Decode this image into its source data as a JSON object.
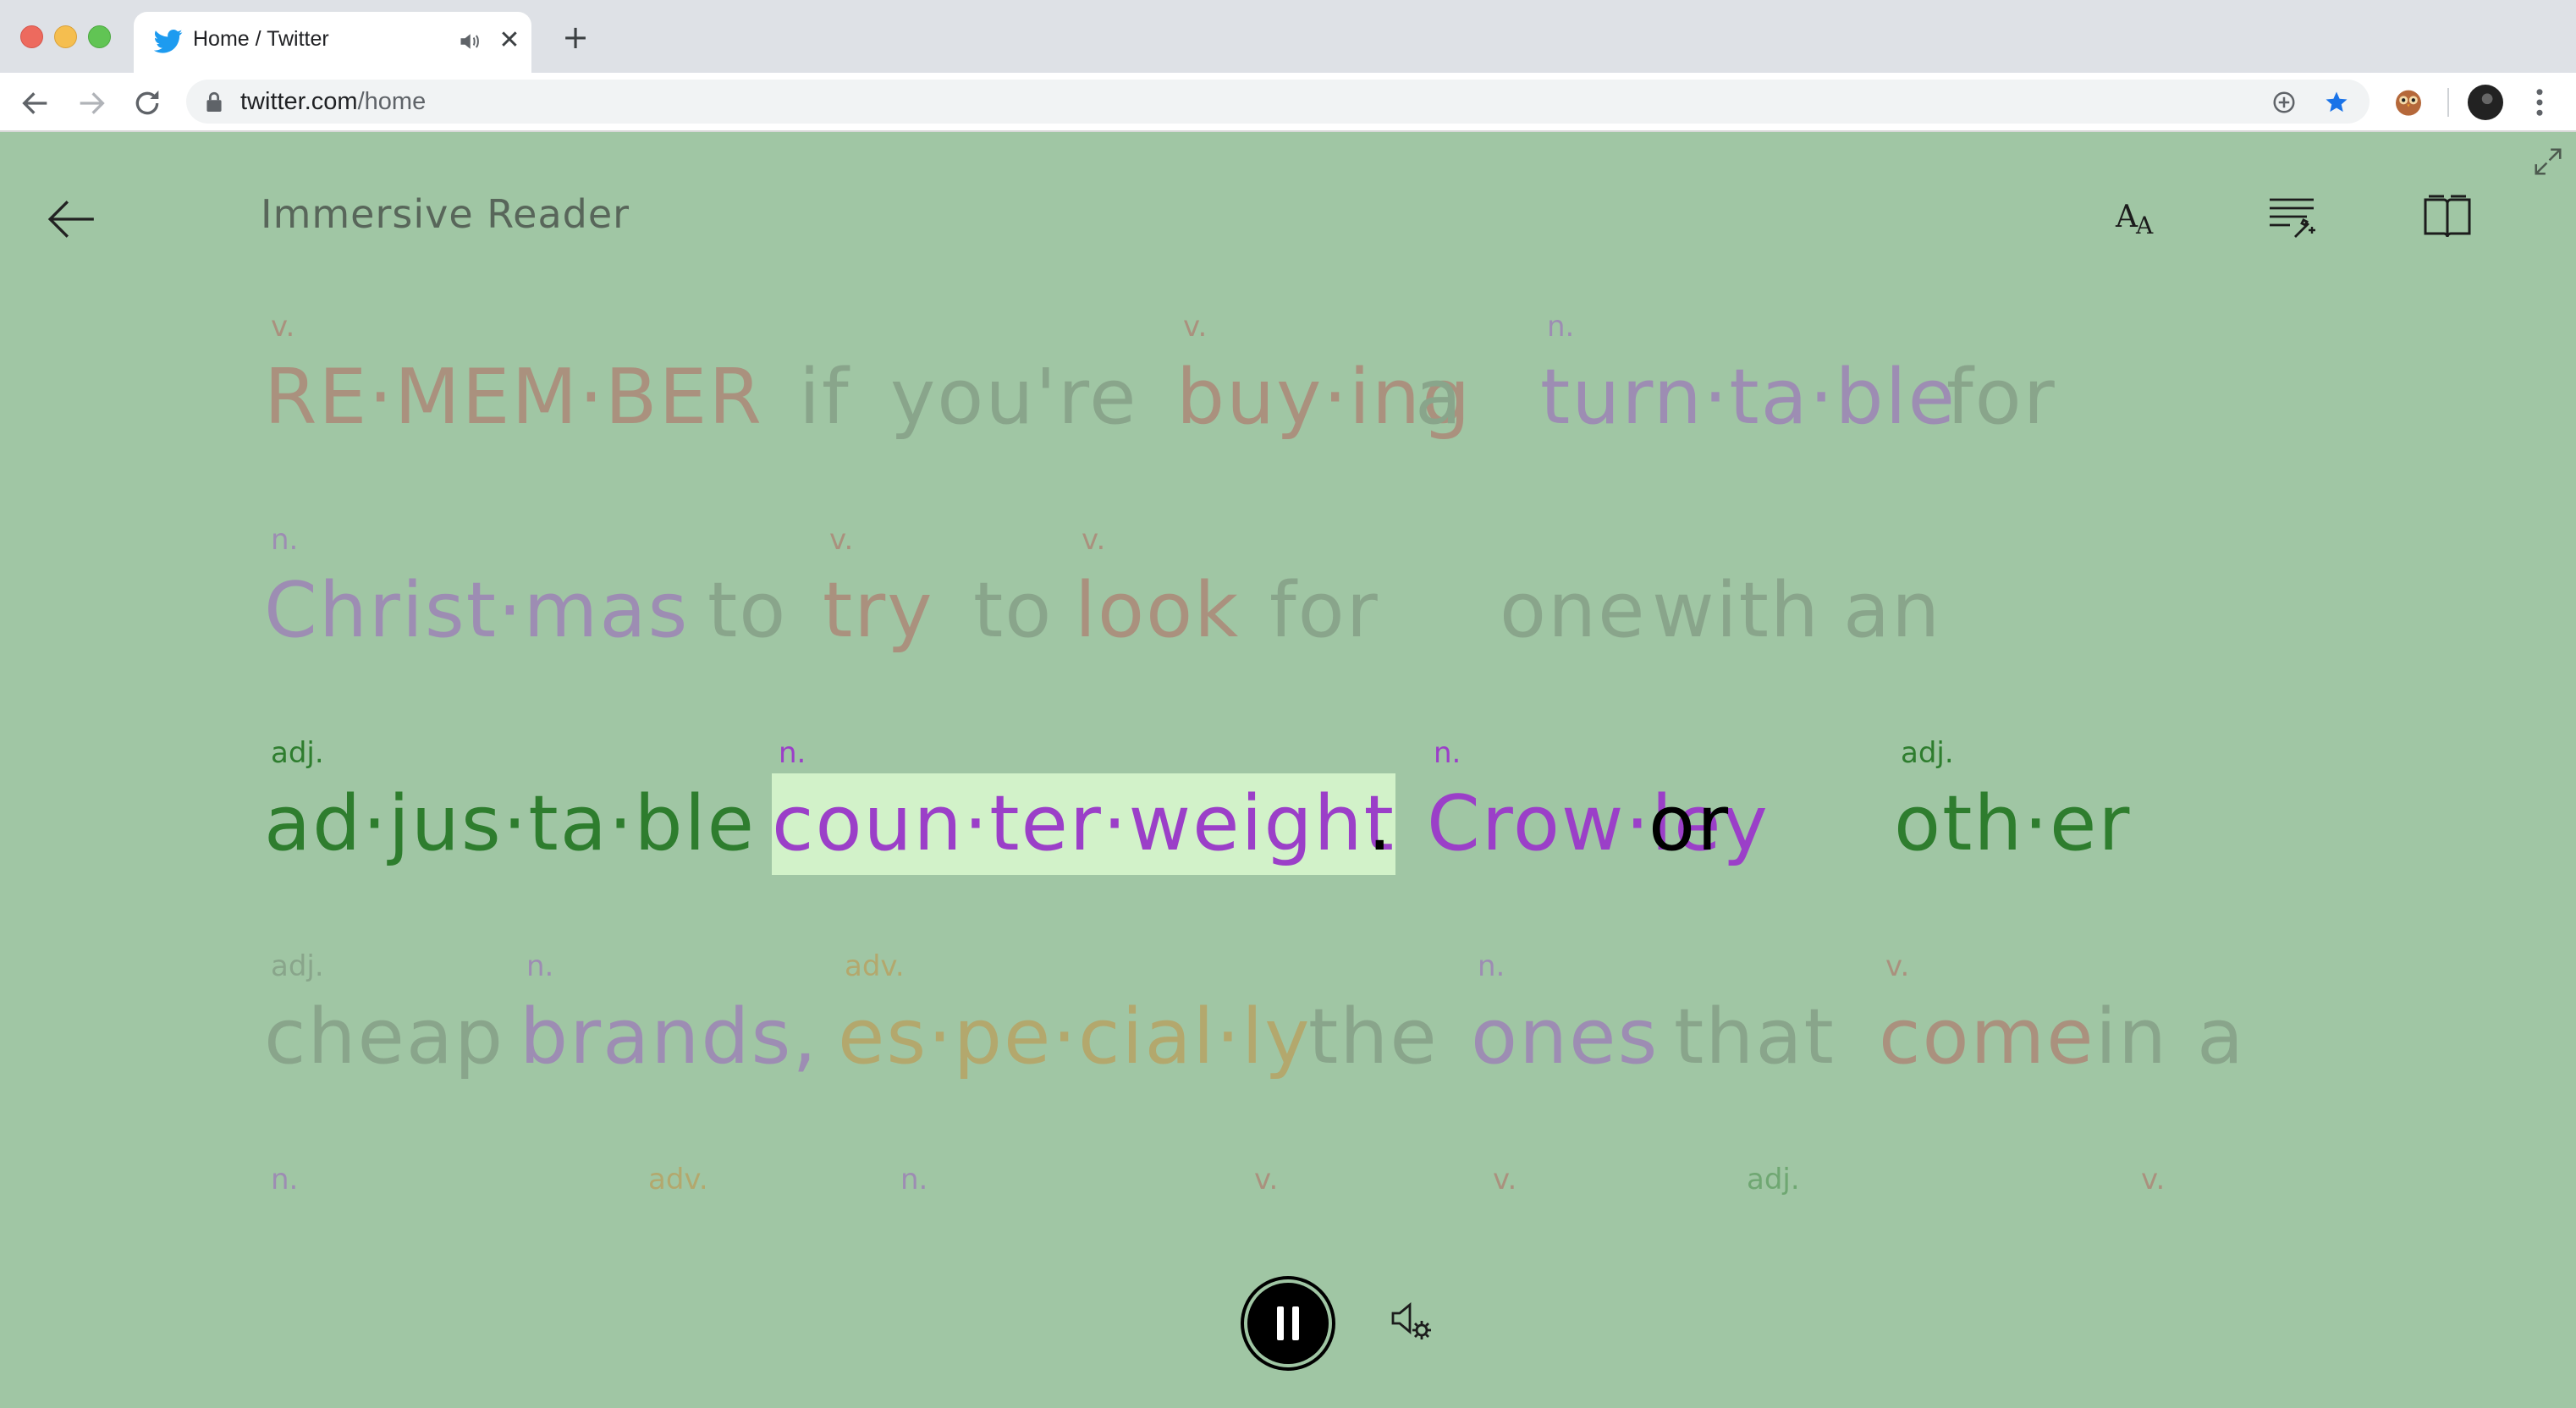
{
  "browser": {
    "tab_title": "Home / Twitter",
    "new_tab_label": "+",
    "close_label": "✕",
    "url_host": "twitter.com",
    "url_path": "/home"
  },
  "reader": {
    "title": "Immersive Reader",
    "lines": [
      {
        "words": [
          {
            "pos": "v.",
            "text": "RE·MEM·BER",
            "cls": "c-v"
          },
          {
            "pos": "",
            "text": "if",
            "cls": "c-g"
          },
          {
            "pos": "",
            "text": "you're",
            "cls": "c-g"
          },
          {
            "pos": "v.",
            "text": "buy·ing",
            "cls": "c-v"
          },
          {
            "pos": "",
            "text": "a",
            "cls": "c-g"
          },
          {
            "pos": "n.",
            "text": "turn·ta·ble",
            "cls": "c-n"
          },
          {
            "pos": "",
            "text": "for",
            "cls": "c-g"
          }
        ]
      },
      {
        "words": [
          {
            "pos": "n.",
            "text": "Christ·mas",
            "cls": "c-n"
          },
          {
            "pos": "",
            "text": "to",
            "cls": "c-g"
          },
          {
            "pos": "v.",
            "text": "try",
            "cls": "c-v"
          },
          {
            "pos": "",
            "text": "to",
            "cls": "c-g"
          },
          {
            "pos": "v.",
            "text": "look",
            "cls": "c-v"
          },
          {
            "pos": "",
            "text": "for",
            "cls": "c-g"
          },
          {
            "pos": "",
            "text": "one",
            "cls": "c-g"
          },
          {
            "pos": "",
            "text": "with",
            "cls": "c-g"
          },
          {
            "pos": "",
            "text": "an",
            "cls": "c-g"
          }
        ]
      },
      {
        "words": [
          {
            "pos": "adj.",
            "text": "ad·jus·ta·ble",
            "cls": "c-adj"
          },
          {
            "pos": "n.",
            "text": "coun·ter·weight",
            "cls": "c-n",
            "highlight": true
          },
          {
            "pos": "",
            "text": ".",
            "cls": "c-x"
          },
          {
            "pos": "n.",
            "text": "Crow·ley",
            "cls": "c-n"
          },
          {
            "pos": "",
            "text": "or",
            "cls": "c-x"
          },
          {
            "pos": "adj.",
            "text": "oth·er",
            "cls": "c-adj"
          }
        ]
      },
      {
        "words": [
          {
            "pos": "adj.",
            "text": "cheap",
            "cls": "c-g"
          },
          {
            "pos": "n.",
            "text": "brands,",
            "cls": "c-n"
          },
          {
            "pos": "adv.",
            "text": "es·pe·cial·ly",
            "cls": "c-adv"
          },
          {
            "pos": "",
            "text": "the",
            "cls": "c-g"
          },
          {
            "pos": "n.",
            "text": "ones",
            "cls": "c-n"
          },
          {
            "pos": "",
            "text": "that",
            "cls": "c-g"
          },
          {
            "pos": "v.",
            "text": "come",
            "cls": "c-v"
          },
          {
            "pos": "",
            "text": "in",
            "cls": "c-g"
          },
          {
            "pos": "",
            "text": "a",
            "cls": "c-g"
          }
        ]
      },
      {
        "words": [
          {
            "pos": "n.",
            "text": "",
            "cls": "c-n"
          },
          {
            "pos": "adv.",
            "text": "",
            "cls": "c-adv"
          },
          {
            "pos": "n.",
            "text": "",
            "cls": "c-n"
          },
          {
            "pos": "v.",
            "text": "",
            "cls": "c-v"
          },
          {
            "pos": "v.",
            "text": "",
            "cls": "c-v"
          },
          {
            "pos": "adj.",
            "text": "",
            "cls": "c-adj"
          },
          {
            "pos": "v.",
            "text": "",
            "cls": "c-v"
          }
        ]
      }
    ]
  },
  "colors": {
    "background": "#a0c6a4",
    "verb": "#b94a4a",
    "noun": "#9b3fc8",
    "adjective": "#2e7d2e",
    "adverb": "#cf7f22",
    "highlight": "#d2f2c9"
  },
  "icons": {
    "back": "arrow-left-icon",
    "text_preferences": "text-size-icon",
    "grammar_options": "grammar-options-icon",
    "reading_preferences": "book-icon",
    "expand": "expand-icon",
    "pause": "pause-icon",
    "voice_settings": "voice-settings-icon"
  }
}
